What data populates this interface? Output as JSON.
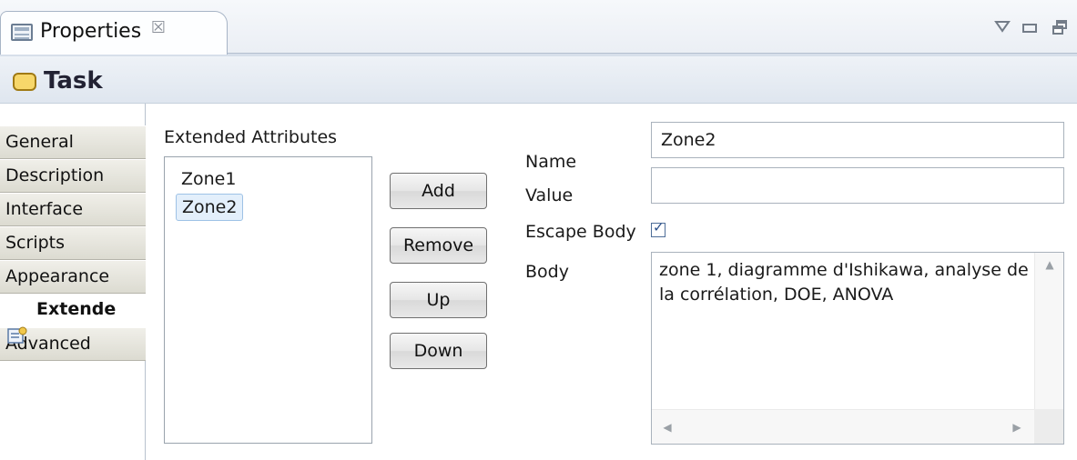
{
  "view_tab": {
    "label": "Properties",
    "close_glyph": "☒",
    "icon": "properties-icon"
  },
  "window_controls": {
    "menu_icon": "view-menu-icon",
    "minimize_icon": "minimize-icon",
    "maximize_icon": "maximize-icon"
  },
  "header": {
    "title": "Task",
    "icon": "task-icon"
  },
  "sidebar": {
    "tabs": [
      {
        "label": "General"
      },
      {
        "label": "Description"
      },
      {
        "label": "Interface"
      },
      {
        "label": "Scripts"
      },
      {
        "label": "Appearance"
      },
      {
        "label": "Extende",
        "active": true,
        "icon": "extended-attributes-icon"
      },
      {
        "label": "Advanced"
      }
    ]
  },
  "extended_attributes": {
    "label": "Extended Attributes",
    "items": [
      "Zone1",
      "Zone2"
    ],
    "selected": "Zone2"
  },
  "buttons": {
    "add": "Add",
    "remove": "Remove",
    "up": "Up",
    "down": "Down"
  },
  "form": {
    "name_label": "Name",
    "name_value": "Zone2",
    "value_label": "Value",
    "value_value": "",
    "escape_label": "Escape Body",
    "escape_checked": true,
    "body_label": "Body",
    "body_value": "zone 1, diagramme d'Ishikawa, analyse de la corrélation, DOE, ANOVA"
  },
  "colors": {
    "accent": "#2a4f8a",
    "selection": "#e3effb",
    "tab_bg": "#dcdbd1"
  }
}
